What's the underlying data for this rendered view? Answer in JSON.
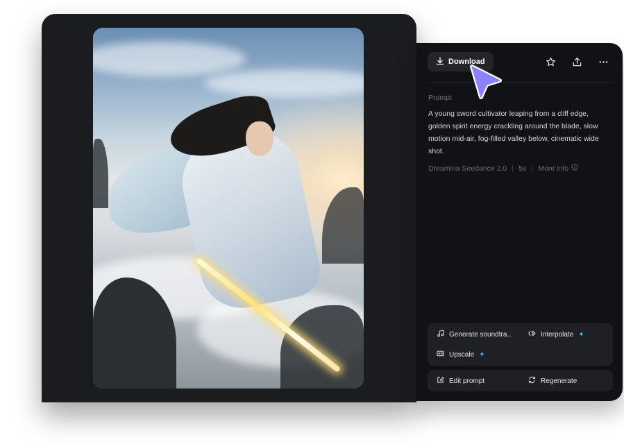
{
  "panel": {
    "download_label": "Download",
    "prompt_label": "Prompt",
    "prompt_text": "A young sword cultivator leaping from a cliff edge, golden spirit energy crackling around the blade, slow motion mid-air, fog-filled valley below, cinematic wide shot.",
    "meta": {
      "model": "Dreamina Seedance 2.0",
      "duration": "5s",
      "more_info": "More info"
    },
    "actions": {
      "generate_soundtrack": "Generate soundtra...",
      "interpolate": "Interpolate",
      "upscale": "Upscale",
      "edit_prompt": "Edit prompt",
      "regenerate": "Regenerate"
    }
  },
  "icons": {
    "download": "download-icon",
    "favorite": "star-icon",
    "share": "share-icon",
    "more": "more-icon",
    "info": "info-icon",
    "music": "music-icon",
    "interpolate": "interpolate-icon",
    "upscale": "hd-icon",
    "edit": "edit-icon",
    "regenerate": "regenerate-icon",
    "sparkle": "sparkle-icon",
    "cursor": "cursor-icon"
  },
  "colors": {
    "panel_bg": "#111216",
    "preview_bg": "#1b1c20",
    "sparkle": "#33c7ff",
    "cursor": "#8b82ff"
  }
}
